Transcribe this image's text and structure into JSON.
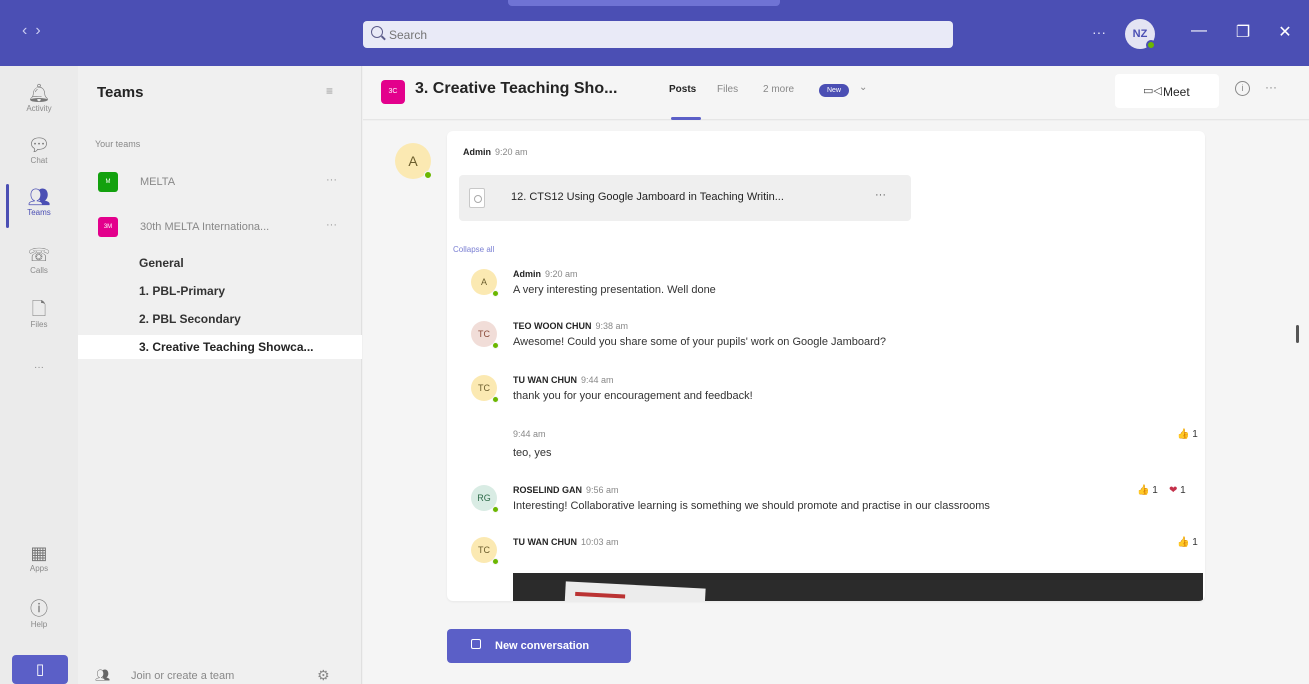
{
  "titlebar": {
    "search_placeholder": "Search",
    "more": "···",
    "avatar_initials": "NZ",
    "minimize": "—",
    "maximize": "❐",
    "close": "✕"
  },
  "rail": {
    "items": [
      {
        "label": "Activity",
        "icon": "bell-icon"
      },
      {
        "label": "Chat",
        "icon": "chat-icon"
      },
      {
        "label": "Teams",
        "icon": "teams-icon"
      },
      {
        "label": "Calls",
        "icon": "phone-icon"
      },
      {
        "label": "Files",
        "icon": "file-icon"
      },
      {
        "label": "Apps",
        "icon": "apps-icon"
      },
      {
        "label": "Help",
        "icon": "help-icon"
      }
    ],
    "more": "···"
  },
  "teams_panel": {
    "title": "Teams",
    "section_label": "Your teams",
    "teams": [
      {
        "initials": "M",
        "name": "MELTA",
        "color": "#13a10e"
      },
      {
        "initials": "3M",
        "name": "30th MELTA Internationa...",
        "color": "#e3008c"
      }
    ],
    "channels": [
      "General",
      "1. PBL-Primary",
      "2. PBL Secondary",
      "3. Creative Teaching Showca..."
    ],
    "join_label": "Join or create a team"
  },
  "header": {
    "tile_initials": "3C",
    "title": "3. Creative Teaching Sho...",
    "tabs": {
      "posts": "Posts",
      "files": "Files",
      "more": "2 more"
    },
    "new_badge": "New",
    "meet_label": "Meet"
  },
  "post": {
    "author": "Admin",
    "time": "9:20 am",
    "avatar": "A",
    "attachment": "12. CTS12 Using Google Jamboard in Teaching Writin...",
    "collapse_label": "Collapse all",
    "replies": [
      {
        "initials": "A",
        "author": "Admin",
        "time": "9:20 am",
        "text": "A very interesting presentation. Well done"
      },
      {
        "initials": "TC",
        "author": "TEO WOON CHUN",
        "time": "9:38 am",
        "text": "Awesome! Could you share some of your pupils' work on Google Jamboard?"
      },
      {
        "initials": "TC",
        "author": "TU WAN CHUN",
        "time": "9:44 am",
        "text": "thank you for your encouragement and feedback!"
      },
      {
        "time": "9:44 am",
        "text": "teo, yes"
      },
      {
        "initials": "RG",
        "author": "ROSELIND GAN",
        "time": "9:56 am",
        "text": "Interesting! Collaborative learning is something we should promote and practise in our classrooms"
      },
      {
        "initials": "TC",
        "author": "TU WAN CHUN",
        "time": "10:03 am",
        "text": ""
      }
    ],
    "reactions": {
      "like": "👍",
      "heart": "❤",
      "count": "1"
    }
  },
  "new_conversation": "New conversation",
  "colors": {
    "brand": "#4b4fb4",
    "accent": "#5b5fc7",
    "online": "#6bb700"
  }
}
